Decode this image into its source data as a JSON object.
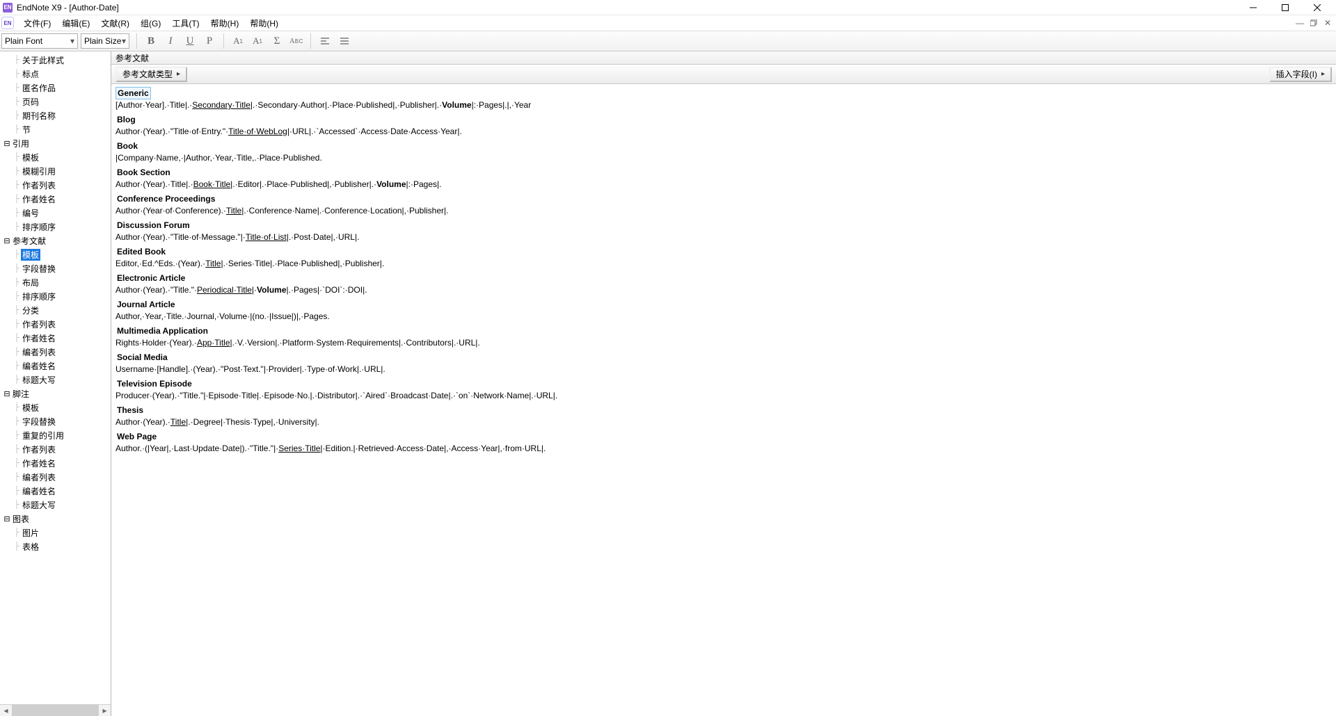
{
  "window": {
    "title": "EndNote X9 - [Author-Date]"
  },
  "menu": {
    "items": [
      "文件(F)",
      "编辑(E)",
      "文献(R)",
      "组(G)",
      "工具(T)",
      "帮助(H)",
      "帮助(H)"
    ]
  },
  "toolbar": {
    "font": "Plain Font",
    "size": "Plain Size"
  },
  "tree": [
    {
      "lvl": 1,
      "label": "关于此样式"
    },
    {
      "lvl": 1,
      "label": "标点"
    },
    {
      "lvl": 1,
      "label": "匿名作品"
    },
    {
      "lvl": 1,
      "label": "页码"
    },
    {
      "lvl": 1,
      "label": "期刊名称"
    },
    {
      "lvl": 1,
      "label": "节"
    },
    {
      "lvl": 0,
      "label": "引用",
      "exp": "minus"
    },
    {
      "lvl": 1,
      "label": "模板"
    },
    {
      "lvl": 1,
      "label": "模糊引用"
    },
    {
      "lvl": 1,
      "label": "作者列表"
    },
    {
      "lvl": 1,
      "label": "作者姓名"
    },
    {
      "lvl": 1,
      "label": "编号"
    },
    {
      "lvl": 1,
      "label": "排序顺序"
    },
    {
      "lvl": 0,
      "label": "参考文献",
      "exp": "minus"
    },
    {
      "lvl": 1,
      "label": "模板",
      "selected": true
    },
    {
      "lvl": 1,
      "label": "字段替换"
    },
    {
      "lvl": 1,
      "label": "布局"
    },
    {
      "lvl": 1,
      "label": "排序顺序"
    },
    {
      "lvl": 1,
      "label": "分类"
    },
    {
      "lvl": 1,
      "label": "作者列表"
    },
    {
      "lvl": 1,
      "label": "作者姓名"
    },
    {
      "lvl": 1,
      "label": "编者列表"
    },
    {
      "lvl": 1,
      "label": "编者姓名"
    },
    {
      "lvl": 1,
      "label": "标题大写"
    },
    {
      "lvl": 0,
      "label": "脚注",
      "exp": "minus"
    },
    {
      "lvl": 1,
      "label": "模板"
    },
    {
      "lvl": 1,
      "label": "字段替换"
    },
    {
      "lvl": 1,
      "label": "重复的引用"
    },
    {
      "lvl": 1,
      "label": "作者列表"
    },
    {
      "lvl": 1,
      "label": "作者姓名"
    },
    {
      "lvl": 1,
      "label": "编者列表"
    },
    {
      "lvl": 1,
      "label": "编者姓名"
    },
    {
      "lvl": 1,
      "label": "标题大写"
    },
    {
      "lvl": 0,
      "label": "图表",
      "exp": "minus"
    },
    {
      "lvl": 1,
      "label": "图片"
    },
    {
      "lvl": 1,
      "label": "表格"
    }
  ],
  "content": {
    "header": "参考文献",
    "btn_reftype": "参考文献类型",
    "btn_insertfield": "插入字段(I)",
    "templates": [
      {
        "name": "Generic",
        "body": "[Author·Year].·Title|.·<u>Secondary·Title</u>|.·Secondary·Author|.·Place·Published|,·Publisher|.·<b>Volume</b>|:·Pages|.|,·Year"
      },
      {
        "name": "Blog",
        "body": "Author·(Year).·\"Title·of·Entry.\"·<u>Title·of·WebLog</u>|·URL|.·`Accessed`·Access·Date·Access·Year|."
      },
      {
        "name": "Book",
        "body": "|Company·Name,·|Author,·Year,·Title,.·Place·Published."
      },
      {
        "name": "Book Section",
        "body": "Author·(Year).·Title|.·<u>Book·Title</u>|.·Editor|.·Place·Published|,·Publisher|.·<b>Volume</b>|:·Pages|."
      },
      {
        "name": "Conference Proceedings",
        "body": "Author·(Year·of·Conference).·<u>Title</u>|.·Conference·Name|.·Conference·Location|,·Publisher|."
      },
      {
        "name": "Discussion Forum",
        "body": "Author·(Year).·\"Title·of·Message.\"|·<u>Title·of·List</u>|.·Post·Date|,·URL|."
      },
      {
        "name": "Edited Book",
        "body": "Editor,·Ed.^Eds.·(Year).·<u>Title</u>|.·Series·Title|.·Place·Published|,·Publisher|."
      },
      {
        "name": "Electronic Article",
        "body": "Author·(Year).·\"Title.\"·<u>Periodical·Title</u>|·<b>Volume</b>|.·Pages|·`DOI`:·DOI|."
      },
      {
        "name": "Journal Article",
        "body": "Author,·Year,·Title.·Journal,·Volume·|(no.·|Issue|)|,·Pages."
      },
      {
        "name": "Multimedia Application",
        "body": "Rights·Holder·(Year).·<u>App·Title</u>|.·V.·Version|.·Platform·System·Requirements|.·Contributors|.·URL|."
      },
      {
        "name": "Social Media",
        "body": "Username·[Handle].·(Year).·\"Post·Text.\"|·Provider|.·Type·of·Work|.·URL|."
      },
      {
        "name": "Television Episode",
        "body": "Producer·(Year).·\"Title.\"|·Episode·Title|.·Episode·No.|.·Distributor|.·`Aired`·Broadcast·Date|.·`on`·Network·Name|.·URL|."
      },
      {
        "name": "Thesis",
        "body": "Author·(Year).·<u>Title</u>|.·Degree|·Thesis·Type|,·University|."
      },
      {
        "name": "Web Page",
        "body": "Author.·(|Year|,·Last·Update·Date|).·\"Title.\"|·<u>Series·Title</u>|·Edition.|·Retrieved·Access·Date|,·Access·Year|,·from·URL|."
      }
    ]
  }
}
